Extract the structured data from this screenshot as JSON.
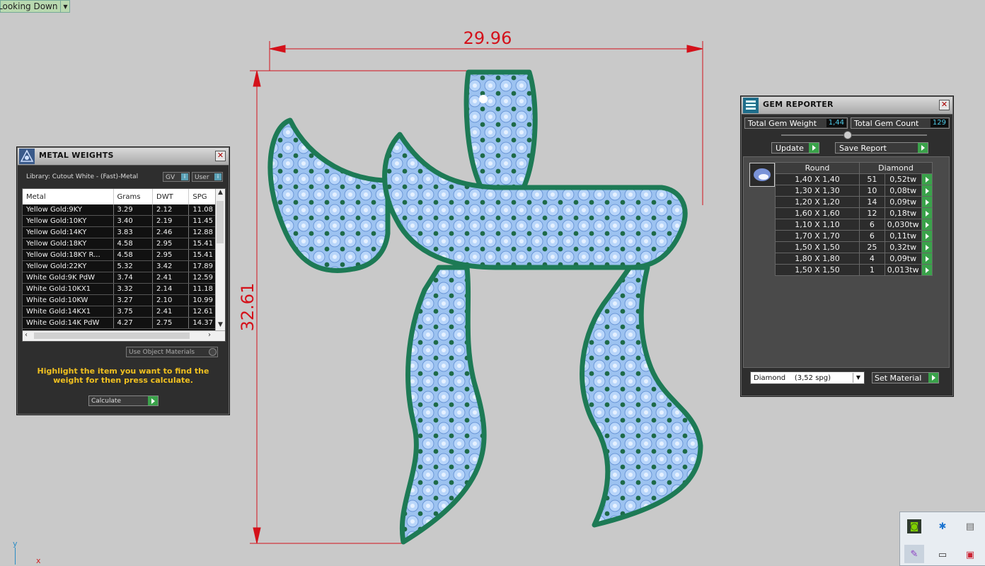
{
  "viewport": {
    "view_label": "Looking Down",
    "dim_width": "29.96",
    "dim_height": "32.61",
    "axis_y": "y",
    "axis_x": "x"
  },
  "metal_weights": {
    "title": "METAL WEIGHTS",
    "library_label": "Library: Cutout White - (Fast)-Metal",
    "toggle_gv": "GV",
    "toggle_user": "User",
    "columns": [
      "Metal",
      "Grams",
      "DWT",
      "SPG"
    ],
    "rows": [
      [
        "Yellow Gold:9KY",
        "3.29",
        "2.12",
        "11.08"
      ],
      [
        "Yellow Gold:10KY",
        "3.40",
        "2.19",
        "11.45"
      ],
      [
        "Yellow Gold:14KY",
        "3.83",
        "2.46",
        "12.88"
      ],
      [
        "Yellow Gold:18KY",
        "4.58",
        "2.95",
        "15.41"
      ],
      [
        "Yellow Gold:18KY R...",
        "4.58",
        "2.95",
        "15.41"
      ],
      [
        "Yellow Gold:22KY",
        "5.32",
        "3.42",
        "17.89"
      ],
      [
        "White Gold:9K PdW",
        "3.74",
        "2.41",
        "12.59"
      ],
      [
        "White Gold:10KX1",
        "3.32",
        "2.14",
        "11.18"
      ],
      [
        "White Gold:10KW",
        "3.27",
        "2.10",
        "10.99"
      ],
      [
        "White Gold:14KX1",
        "3.75",
        "2.41",
        "12.61"
      ],
      [
        "White Gold:14K PdW",
        "4.27",
        "2.75",
        "14.37"
      ]
    ],
    "use_object_materials": "Use Object Materials",
    "hint": "Highlight the item you want to find the weight for then press calculate.",
    "calculate_label": "Calculate"
  },
  "gem_reporter": {
    "title": "GEM REPORTER",
    "total_weight_label": "Total Gem Weight",
    "total_weight_value": "1,44",
    "total_count_label": "Total Gem Count",
    "total_count_value": "129",
    "update_label": "Update",
    "save_report_label": "Save Report",
    "col_shape": "Round",
    "col_material": "Diamond",
    "gems": [
      [
        "1,40 X 1,40",
        "51",
        "0,52tw"
      ],
      [
        "1,30 X 1,30",
        "10",
        "0,08tw"
      ],
      [
        "1,20 X 1,20",
        "14",
        "0,09tw"
      ],
      [
        "1,60 X 1,60",
        "12",
        "0,18tw"
      ],
      [
        "1,10 X 1,10",
        "6",
        "0,030tw"
      ],
      [
        "1,70 X 1,70",
        "6",
        "0,11tw"
      ],
      [
        "1,50 X 1,50",
        "25",
        "0,32tw"
      ],
      [
        "1,80 X 1,80",
        "4",
        "0,09tw"
      ],
      [
        "1,50 X 1,50",
        "1",
        "0,013tw"
      ]
    ],
    "material_select": "Diamond    (3,52 spg)",
    "set_material_label": "Set Material"
  },
  "colors": {
    "metal_green": "#1d7a55",
    "gem_blue": "#8ab8ee",
    "dimension_red": "#d4111a",
    "hint_yellow": "#f0c020"
  }
}
